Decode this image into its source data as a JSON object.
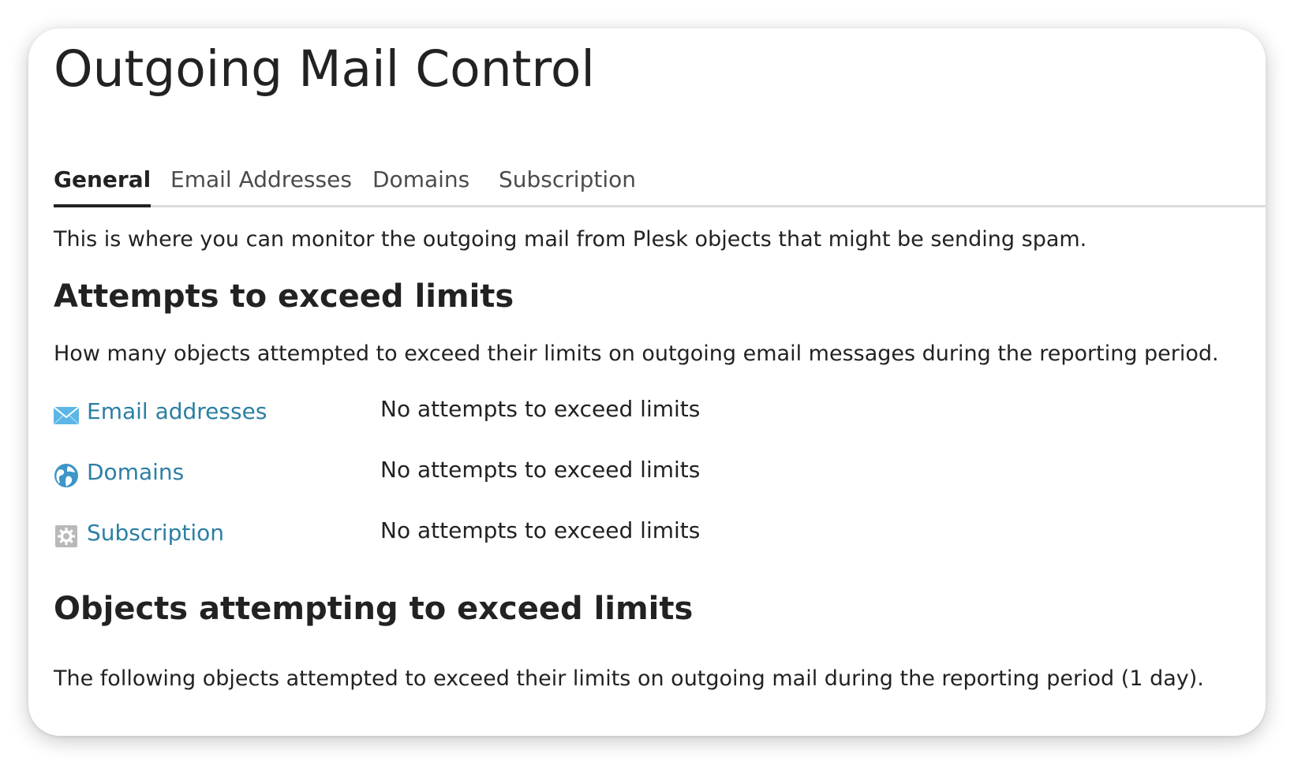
{
  "page": {
    "title": "Outgoing Mail Control",
    "intro": "This is where you can monitor the outgoing mail from Plesk objects that might be sending spam."
  },
  "tabs": [
    {
      "label": "General",
      "active": true
    },
    {
      "label": "Email Addresses",
      "active": false
    },
    {
      "label": "Domains",
      "active": false
    },
    {
      "label": "Subscription",
      "active": false
    }
  ],
  "attempts_section": {
    "heading": "Attempts to exceed limits",
    "description": "How many objects attempted to exceed their limits on outgoing email messages during the reporting period.",
    "rows": [
      {
        "icon": "envelope-icon",
        "label": "Email addresses",
        "value": "No attempts to exceed limits"
      },
      {
        "icon": "globe-icon",
        "label": "Domains",
        "value": "No attempts to exceed limits"
      },
      {
        "icon": "gear-icon",
        "label": "Subscription",
        "value": "No attempts to exceed limits"
      }
    ]
  },
  "objects_section": {
    "heading": "Objects attempting to exceed limits",
    "description": "The following objects attempted to exceed their limits on outgoing mail during the reporting period (1 day)."
  },
  "colors": {
    "link": "#2b7fa3",
    "text": "#222222",
    "tab_inactive": "#4b4b4b",
    "divider": "#dcdcdc",
    "icon_blue": "#5bb6e6",
    "icon_gray": "#b9b9b9"
  }
}
